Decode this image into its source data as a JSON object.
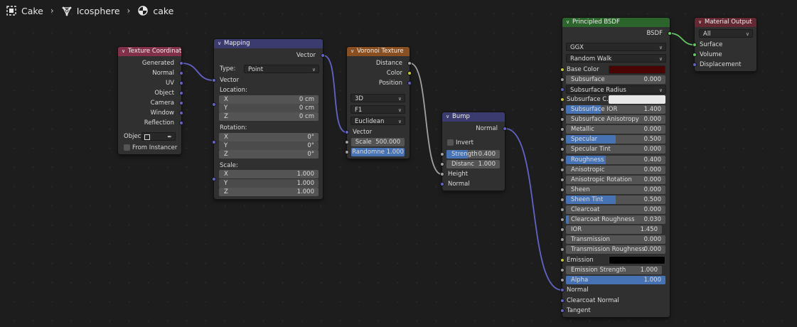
{
  "breadcrumb": {
    "object": "Cake",
    "mesh": "Icosphere",
    "material": "cake"
  },
  "colors": {
    "wire_vector": "#6363c7",
    "wire_float": "#a1a1a1",
    "wire_shader": "#63c763",
    "base_color": "#4a0404",
    "emission": "#000000",
    "subsurface_color": "#e8e8e8",
    "field_fill": "#4772b3"
  },
  "texcoord": {
    "title": "Texture Coordinate",
    "outputs": [
      "Generated",
      "Normal",
      "UV",
      "Object",
      "Camera",
      "Window",
      "Reflection"
    ],
    "object_label": "Object",
    "from_instancer": "From Instancer"
  },
  "mapping": {
    "title": "Mapping",
    "output": "Vector",
    "type_label": "Type:",
    "type_value": "Point",
    "input_vector": "Vector",
    "location_label": "Location:",
    "location": [
      {
        "axis": "X",
        "value": "0 cm"
      },
      {
        "axis": "Y",
        "value": "0 cm"
      },
      {
        "axis": "Z",
        "value": "0 cm"
      }
    ],
    "rotation_label": "Rotation:",
    "rotation": [
      {
        "axis": "X",
        "value": "0°"
      },
      {
        "axis": "Y",
        "value": "0°"
      },
      {
        "axis": "Z",
        "value": "0°"
      }
    ],
    "scale_label": "Scale:",
    "scale": [
      {
        "axis": "X",
        "value": "1.000"
      },
      {
        "axis": "Y",
        "value": "1.000"
      },
      {
        "axis": "Z",
        "value": "1.000"
      }
    ]
  },
  "voronoi": {
    "title": "Voronoi Texture",
    "outputs": [
      "Distance",
      "Color",
      "Position"
    ],
    "dimensions": "3D",
    "feature": "F1",
    "metric": "Euclidean",
    "input_vector": "Vector",
    "scale_label": "Scale",
    "scale_value": "500.000",
    "randomness_label": "Randomne",
    "randomness_value": "1.000",
    "randomness_fill": 1.0
  },
  "bump": {
    "title": "Bump",
    "output": "Normal",
    "invert": "Invert",
    "strength_label": "Strength",
    "strength_value": "0.400",
    "strength_fill": 0.4,
    "distance_label": "Distanc",
    "distance_value": "1.000",
    "height": "Height",
    "normal": "Normal"
  },
  "bsdf": {
    "title": "Principled BSDF",
    "output": "BSDF",
    "distribution": "GGX",
    "subsurface_method": "Random Walk",
    "base_color_label": "Base Color",
    "subsurface": {
      "label": "Subsurface",
      "value": "0.000",
      "fill": 0.0
    },
    "subsurface_radius": "Subsurface Radius",
    "subsurface_color_label": "Subsurface C...",
    "params": [
      {
        "label": "Subsurface IOR",
        "value": "1.400",
        "fill": 0.35
      },
      {
        "label": "Subsurface Anisotropy",
        "value": "0.000",
        "fill": 0.0
      },
      {
        "label": "Metallic",
        "value": "0.000",
        "fill": 0.0
      },
      {
        "label": "Specular",
        "value": "0.500",
        "fill": 0.5
      },
      {
        "label": "Specular Tint",
        "value": "0.000",
        "fill": 0.0
      },
      {
        "label": "Roughness",
        "value": "0.400",
        "fill": 0.4
      },
      {
        "label": "Anisotropic",
        "value": "0.000",
        "fill": 0.0
      },
      {
        "label": "Anisotropic Rotation",
        "value": "0.000",
        "fill": 0.0
      },
      {
        "label": "Sheen",
        "value": "0.000",
        "fill": 0.0
      },
      {
        "label": "Sheen Tint",
        "value": "0.500",
        "fill": 0.5
      },
      {
        "label": "Clearcoat",
        "value": "0.000",
        "fill": 0.0
      },
      {
        "label": "Clearcoat Roughness",
        "value": "0.030",
        "fill": 0.03
      },
      {
        "label": "IOR",
        "value": "1.450",
        "fill": 0.0
      },
      {
        "label": "Transmission",
        "value": "0.000",
        "fill": 0.0
      },
      {
        "label": "Transmission Roughness",
        "value": "0.000",
        "fill": 0.0
      }
    ],
    "emission_label": "Emission",
    "emission_strength": {
      "label": "Emission Strength",
      "value": "1.000"
    },
    "alpha": {
      "label": "Alpha",
      "value": "1.000",
      "fill": 1.0
    },
    "normal": "Normal",
    "clearcoat_normal": "Clearcoat Normal",
    "tangent": "Tangent"
  },
  "matout": {
    "title": "Material Output",
    "target": "All",
    "inputs": [
      "Surface",
      "Volume",
      "Displacement"
    ]
  }
}
